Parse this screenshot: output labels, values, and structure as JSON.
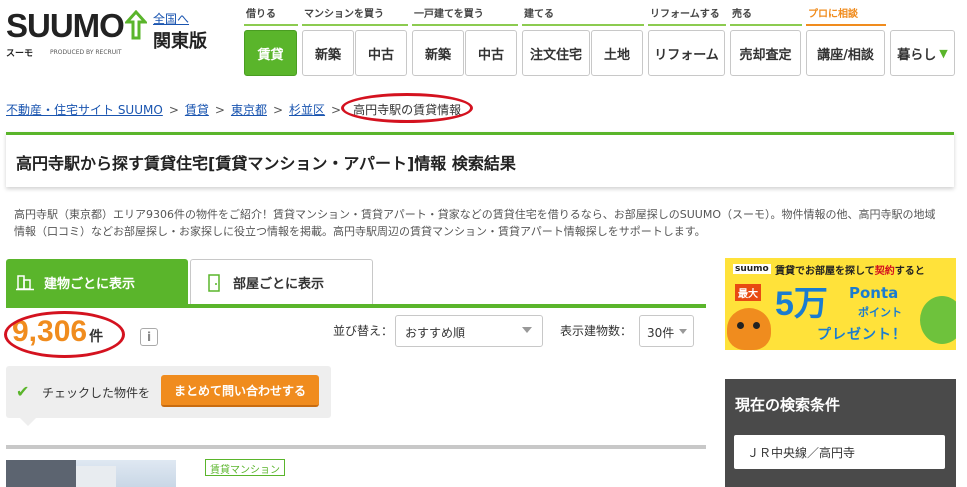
{
  "header": {
    "logo_text": "SUUMO",
    "logo_sub": "スーモ",
    "logo_by": "PRODUCED BY RECRUIT",
    "region_link": "全国へ",
    "region_name": "関東版",
    "nav": [
      {
        "label": "借りる",
        "buttons": [
          "賃貸"
        ]
      },
      {
        "label": "マンションを買う",
        "buttons": [
          "新築",
          "中古"
        ]
      },
      {
        "label": "一戸建てを買う",
        "buttons": [
          "新築",
          "中古"
        ]
      },
      {
        "label": "建てる",
        "buttons": [
          "注文住宅",
          "土地"
        ]
      },
      {
        "label": "リフォームする",
        "buttons": [
          "リフォーム"
        ]
      },
      {
        "label": "売る",
        "buttons": [
          "売却査定"
        ]
      },
      {
        "label": "プロに相談",
        "buttons": [
          "講座/相談"
        ]
      },
      {
        "label": "",
        "buttons": [
          "暮らし"
        ]
      }
    ],
    "active_color": "#5ab52b",
    "accent_orange": "#f08c1e"
  },
  "breadcrumb": {
    "items": [
      "不動産・住宅サイト SUUMO",
      "賃貸",
      "東京都",
      "杉並区"
    ],
    "separator": ">",
    "current": "高円寺駅の賃貸情報"
  },
  "title": "高円寺駅から探す賃貸住宅[賃貸マンション・アパート]情報 検索結果",
  "intro": "高円寺駅（東京都）エリア9306件の物件をご紹介！賃貸マンション・賃貸アパート・貸家などの賃貸住宅を借りるなら、お部屋探しのSUUMO（スーモ）。物件情報の他、高円寺駅の地域情報（口コミ）などお部屋探し・お家探しに役立つ情報を掲載。高円寺駅周辺の賃貸マンション・賃貸アパート情報探しをサポートします。",
  "tabs": [
    {
      "label": "建物ごとに表示",
      "active": true
    },
    {
      "label": "部屋ごとに表示",
      "active": false
    }
  ],
  "results": {
    "count": "9,306",
    "unit": "件",
    "info_icon": "i"
  },
  "sort": {
    "label": "並び替え：",
    "value": "おすすめ順",
    "display_label": "表示建物数：",
    "display_value": "30件"
  },
  "checked": {
    "text": "チェックした物件を",
    "button": "まとめて問い合わせする"
  },
  "listing": {
    "type_badge": "賃貸マンション"
  },
  "ad": {
    "logo": "suumo",
    "top_prefix": "賃貸でお部屋を探して",
    "top_em": "契約",
    "top_suffix": "すると",
    "max": "最大",
    "amount": "5万",
    "ponta": "Ponta",
    "point": "ポイント",
    "present": "プレゼント！"
  },
  "conditions": {
    "title": "現在の検索条件",
    "items": [
      "ＪＲ中央線／高円寺"
    ]
  }
}
